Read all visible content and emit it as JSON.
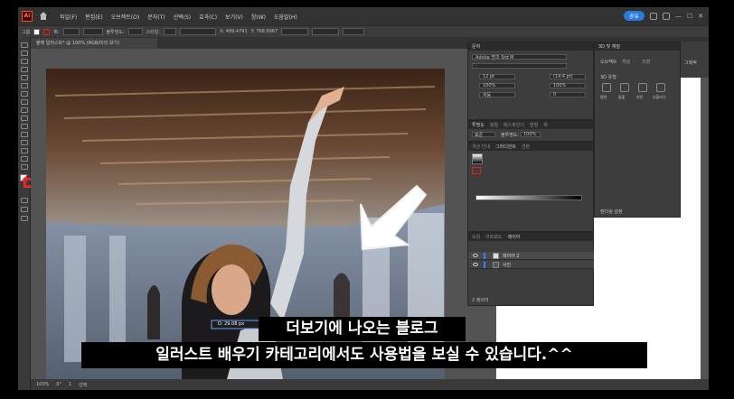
{
  "menu": {
    "logo": "Ai",
    "items": [
      "파일(F)",
      "편집(E)",
      "오브젝트(O)",
      "문자(T)",
      "선택(S)",
      "효과(C)",
      "보기(V)",
      "창(W)",
      "도움말(H)"
    ],
    "share_label": "공유"
  },
  "control_bar": {
    "label_group": "그룹",
    "label_stroke": "획:",
    "label_opacity": "불투명도:",
    "label_style": "스타일:",
    "x_value": "X: 489.4791",
    "y_value": "Y: 768.6967"
  },
  "document_tab": "블랙 일러스트*  @ 100% (RGB/미리 보기)",
  "panels": {
    "character": {
      "title": "문자",
      "font": "Adobe 명조 Std M",
      "font_style": "-",
      "size": "12 pt",
      "leading": "(14.4 pt)",
      "scale_h": "100%",
      "scale_v": "100%",
      "tracking": "0",
      "kerning": "자동"
    },
    "transparency": {
      "tabs": [
        "투명도",
        "정렬",
        "패스파인더",
        "변형",
        "획"
      ],
      "mode": "표준",
      "opacity_label": "불투명도:",
      "opacity": "100%"
    },
    "gradient": {
      "tabs": [
        "색상 안내",
        "그라디언트",
        "견본"
      ]
    },
    "layers": {
      "tabs": [
        "속성",
        "레이어",
        "아트보드"
      ],
      "items": [
        "레이어 2",
        "사진"
      ],
      "footer": "2 레이어"
    },
    "properties": {
      "title": "3D 및 재질",
      "tabs": [
        "오브젝트",
        "재질",
        "조명"
      ],
      "section": "3D 유형",
      "types": [
        "평면",
        "돌출",
        "회전",
        "부풀리기"
      ],
      "render_label": "렌더링 설정"
    },
    "side": {
      "label": "그래픽"
    }
  },
  "measure_tooltip": "D: 29.08 px",
  "status": {
    "zoom": "100%",
    "angle": "0°",
    "page": "1",
    "tool": "선택"
  },
  "subtitles": {
    "line1": "더보기에 나오는 블로그",
    "line2": "일러스트 배우기 카테고리에서도 사용법을 보실 수 있습니다.^^"
  },
  "colors": {
    "accent": "#2a7bd8",
    "selection": "#e02020",
    "canvas": "#535353",
    "panel": "#3d3d3d"
  }
}
